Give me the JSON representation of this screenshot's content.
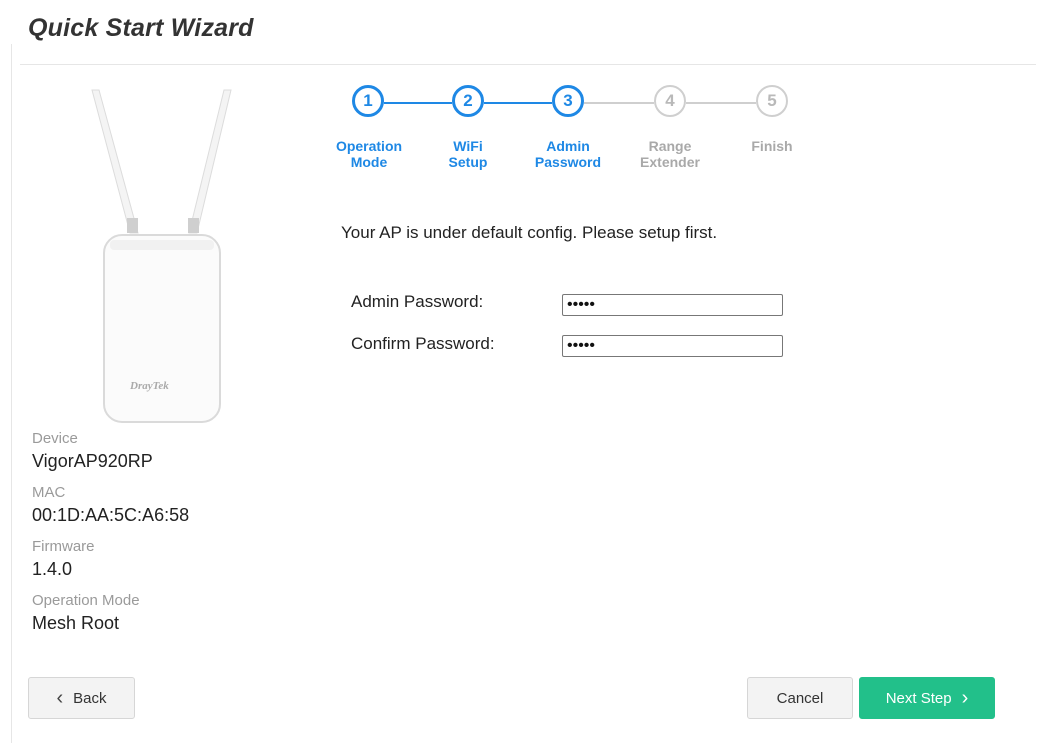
{
  "page": {
    "title": "Quick Start Wizard"
  },
  "device_image": {
    "brand": "DrayTek"
  },
  "device_info": [
    {
      "label": "Device",
      "value": "VigorAP920RP"
    },
    {
      "label": "MAC",
      "value": "00:1D:AA:5C:A6:58"
    },
    {
      "label": "Firmware",
      "value": "1.4.0"
    },
    {
      "label": "Operation Mode",
      "value": "Mesh Root"
    }
  ],
  "stepper": {
    "active_color": "#1e88e5",
    "inactive_color": "#cfcfcf",
    "steps": [
      {
        "number": "1",
        "line1": "Operation",
        "line2": "Mode",
        "state": "done"
      },
      {
        "number": "2",
        "line1": "WiFi",
        "line2": "Setup",
        "state": "done"
      },
      {
        "number": "3",
        "line1": "Admin",
        "line2": "Password",
        "state": "current"
      },
      {
        "number": "4",
        "line1": "Range",
        "line2": "Extender",
        "state": "pending"
      },
      {
        "number": "5",
        "line1": "Finish",
        "line2": "",
        "state": "pending"
      }
    ]
  },
  "form": {
    "notice": "Your AP is under default config. Please setup first.",
    "admin_password": {
      "label": "Admin Password:",
      "value": "admin"
    },
    "confirm_password": {
      "label": "Confirm Password:",
      "value": "admin"
    }
  },
  "buttons": {
    "back": "Back",
    "cancel": "Cancel",
    "next": "Next Step",
    "next_color": "#22c08a"
  }
}
